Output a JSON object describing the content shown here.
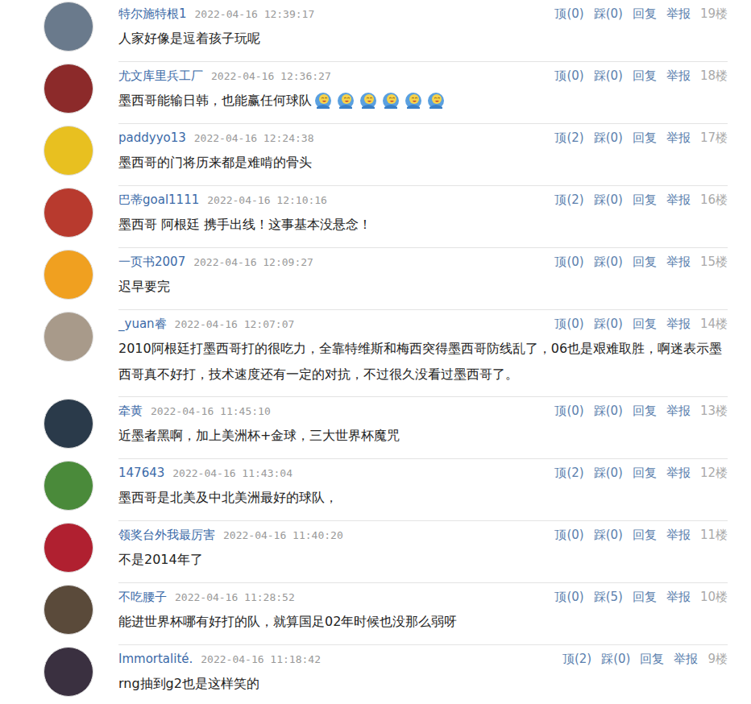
{
  "comments": [
    {
      "user": "特尔施特根1",
      "time": "2022-04-16 12:39:17",
      "up": "顶(0)",
      "down": "踩(0)",
      "reply": "回复",
      "report": "举报",
      "floor": "19楼",
      "text": "人家好像是逗着孩子玩呢",
      "emoticons": 0,
      "color": "#6a7a8c"
    },
    {
      "user": "尤文库里兵工厂",
      "time": "2022-04-16 12:36:27",
      "up": "顶(0)",
      "down": "踩(0)",
      "reply": "回复",
      "report": "举报",
      "floor": "18楼",
      "text": "墨西哥能输日韩，也能赢任何球队",
      "emoticons": 6,
      "color": "#8c2a2a"
    },
    {
      "user": "paddyyo13",
      "time": "2022-04-16 12:24:38",
      "up": "顶(2)",
      "down": "踩(0)",
      "reply": "回复",
      "report": "举报",
      "floor": "17楼",
      "text": "墨西哥的门将历来都是难啃的骨头",
      "emoticons": 0,
      "color": "#e8c020"
    },
    {
      "user": "巴蒂goal1111",
      "time": "2022-04-16 12:10:16",
      "up": "顶(2)",
      "down": "踩(0)",
      "reply": "回复",
      "report": "举报",
      "floor": "16楼",
      "text": "墨西哥 阿根廷 携手出线！这事基本没悬念！",
      "emoticons": 0,
      "color": "#b83a2e"
    },
    {
      "user": "一页书2007",
      "time": "2022-04-16 12:09:27",
      "up": "顶(0)",
      "down": "踩(0)",
      "reply": "回复",
      "report": "举报",
      "floor": "15楼",
      "text": "迟早要完",
      "emoticons": 0,
      "color": "#f0a020"
    },
    {
      "user": "_yuan睿",
      "time": "2022-04-16 12:07:07",
      "up": "顶(0)",
      "down": "踩(0)",
      "reply": "回复",
      "report": "举报",
      "floor": "14楼",
      "text": "2010阿根廷打墨西哥打的很吃力，全靠特维斯和梅西突得墨西哥防线乱了，06也是艰难取胜，啊迷表示墨西哥真不好打，技术速度还有一定的对抗，不过很久没看过墨西哥了。",
      "emoticons": 0,
      "color": "#a89a8a"
    },
    {
      "user": "牵黄",
      "time": "2022-04-16 11:45:10",
      "up": "顶(0)",
      "down": "踩(0)",
      "reply": "回复",
      "report": "举报",
      "floor": "13楼",
      "text": "近墨者黑啊，加上美洲杯+金球，三大世界杯魔咒",
      "emoticons": 0,
      "color": "#2a3a4a"
    },
    {
      "user": "147643",
      "time": "2022-04-16 11:43:04",
      "up": "顶(2)",
      "down": "踩(0)",
      "reply": "回复",
      "report": "举报",
      "floor": "12楼",
      "text": "墨西哥是北美及中北美洲最好的球队，",
      "emoticons": 0,
      "color": "#4a8a3a"
    },
    {
      "user": "领奖台外我最厉害",
      "time": "2022-04-16 11:40:20",
      "up": "顶(0)",
      "down": "踩(0)",
      "reply": "回复",
      "report": "举报",
      "floor": "11楼",
      "text": "不是2014年了",
      "emoticons": 0,
      "color": "#b02030"
    },
    {
      "user": "不吃腰子",
      "time": "2022-04-16 11:28:52",
      "up": "顶(0)",
      "down": "踩(5)",
      "reply": "回复",
      "report": "举报",
      "floor": "10楼",
      "text": "能进世界杯哪有好打的队，就算国足02年时候也没那么弱呀",
      "emoticons": 0,
      "color": "#5a4a3a"
    },
    {
      "user": "Immortalité.",
      "time": "2022-04-16 11:18:42",
      "up": "顶(2)",
      "down": "踩(0)",
      "reply": "回复",
      "report": "举报",
      "floor": "9楼",
      "text": "rng抽到g2也是这样笑的",
      "emoticons": 0,
      "color": "#3a3040"
    }
  ]
}
